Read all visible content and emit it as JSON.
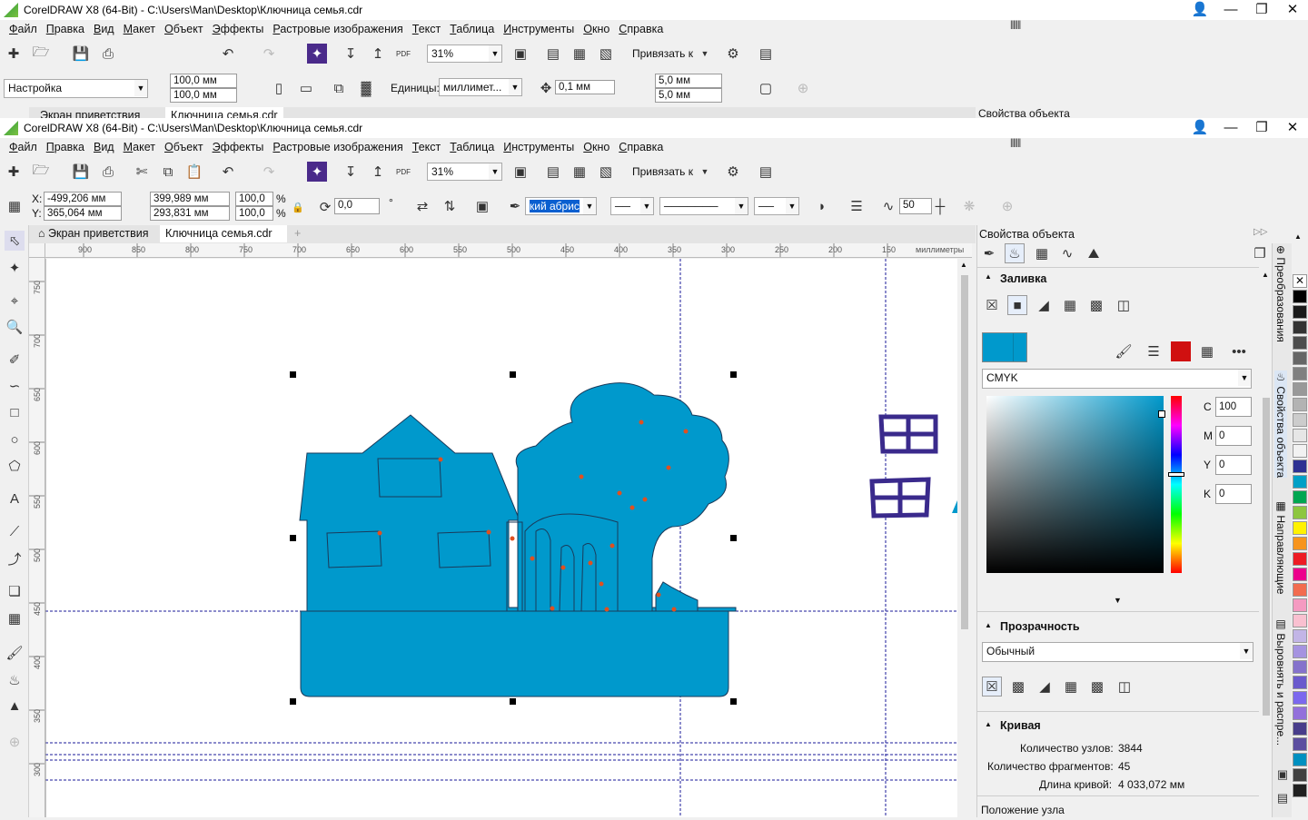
{
  "window_back": {
    "title": "CorelDRAW X8 (64-Bit) - C:\\Users\\Man\\Desktop\\Ключница семья.cdr"
  },
  "window": {
    "title": "CorelDRAW X8 (64-Bit) - C:\\Users\\Man\\Desktop\\Ключница семья.cdr"
  },
  "menu": [
    "Файл",
    "Правка",
    "Вид",
    "Макет",
    "Объект",
    "Эффекты",
    "Растровые изображения",
    "Текст",
    "Таблица",
    "Инструменты",
    "Окно",
    "Справка"
  ],
  "standard_toolbar": {
    "zoom": "31%",
    "snap_to": "Привязать к"
  },
  "back_property_bar": {
    "preset": "Настройка",
    "width": "100,0 мм",
    "height": "100,0 мм",
    "units_label": "Единицы:",
    "units": "миллимет...",
    "nudge": "0,1 мм",
    "dup_x": "5,0 мм",
    "dup_y": "5,0 мм"
  },
  "back_tabs": {
    "welcome": "Экран приветствия",
    "doc": "Ключница семья.cdr",
    "panel": "Свойства объекта"
  },
  "property_bar": {
    "x_label": "X:",
    "x": "-499,206 мм",
    "y_label": "Y:",
    "y": "365,064 мм",
    "w": "399,989 мм",
    "h": "293,831 мм",
    "sx": "100,0",
    "sy": "100,0",
    "pct": "%",
    "angle": "0,0",
    "deg": "°",
    "outline": "кий абрис",
    "smooth": "50"
  },
  "tabs": {
    "welcome": "Экран приветствия",
    "doc": "Ключница семья.cdr"
  },
  "ruler_h": [
    "900",
    "850",
    "800",
    "750",
    "700",
    "650",
    "600",
    "550",
    "500",
    "450",
    "400",
    "350",
    "300",
    "250",
    "200",
    "150"
  ],
  "ruler_units": "миллиметры",
  "ruler_v": [
    "750",
    "700",
    "650",
    "600",
    "550",
    "500",
    "450",
    "400",
    "350",
    "300"
  ],
  "docker": {
    "title": "Свойства объекта",
    "fill_section": "Заливка",
    "color_model": "CMYK",
    "cmyk": {
      "C_label": "C",
      "C": "100",
      "M_label": "M",
      "M": "0",
      "Y_label": "Y",
      "Y": "0",
      "K_label": "K",
      "K": "0"
    },
    "transparency_section": "Прозрачность",
    "transparency_mode": "Обычный",
    "curve_section": "Кривая",
    "nodes_label": "Количество узлов:",
    "nodes": "3844",
    "fragments_label": "Количество фрагментов:",
    "fragments": "45",
    "length_label": "Длина кривой:",
    "length": "4 033,072 мм",
    "node_pos": "Положение узла"
  },
  "side_tabs": [
    "Преобразования",
    "Свойства объекта",
    "Направляющие",
    "Выровнять и распре..."
  ],
  "colors": {
    "fill": "#0099cc",
    "window_purple": "#3a2a8c",
    "palette": [
      "#ffffff",
      "#000000",
      "#1a1a1a",
      "#333333",
      "#4d4d4d",
      "#666666",
      "#808080",
      "#999999",
      "#b3b3b3",
      "#cccccc",
      "#e6e6e6",
      "#f2f2f2",
      "#2e3192",
      "#00a0c6",
      "#00a651",
      "#8dc63f",
      "#fff200",
      "#f7941d",
      "#ed1c24",
      "#ec008c",
      "#f26c4f",
      "#f49ac1",
      "#f9c0d0",
      "#c2b5e6",
      "#a593e0",
      "#8472cc",
      "#6a5acd",
      "#7b68ee",
      "#9370db",
      "#483d8b",
      "#5c4ea0",
      "#0090c0",
      "#404040",
      "#202020"
    ]
  }
}
